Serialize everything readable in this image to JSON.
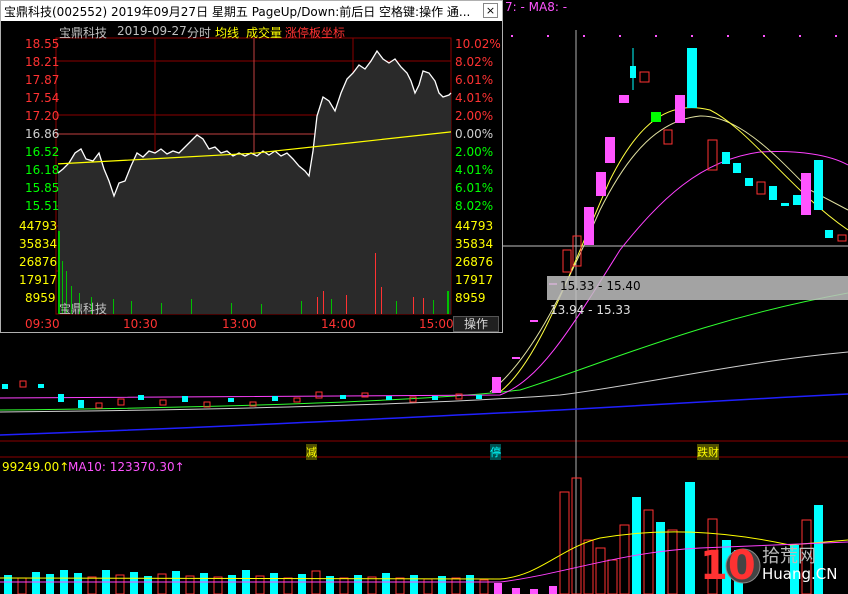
{
  "popup": {
    "title": "宝鼎科技(002552)  2019年09月27日  星期五  PageUp/Down:前后日  空格键:操作  通...",
    "close_glyph": "×",
    "stock_name": "宝鼎科技",
    "date": "2019-09-27",
    "chart_mode": "分时",
    "legend_avg": "均线",
    "legend_volume": "成交量",
    "legend_limit": "涨停板坐标",
    "vol_stock_name": "宝鼎科技",
    "operate_button": "操作",
    "price_levels": [
      "18.55",
      "18.21",
      "17.87",
      "17.54",
      "17.20",
      "16.86",
      "16.52",
      "16.18",
      "15.85",
      "15.51"
    ],
    "pct_levels": [
      "10.02%",
      "8.02%",
      "6.01%",
      "4.01%",
      "2.00%",
      "0.00%",
      "2.00%",
      "4.01%",
      "6.01%",
      "8.02%"
    ],
    "volume_levels": [
      "44793",
      "35834",
      "26876",
      "17917",
      "8959"
    ],
    "time_labels": [
      "09:30",
      "10:30",
      "13:00",
      "14:00",
      "15:00"
    ]
  },
  "kline": {
    "ma_header": "7: -   MA8: -",
    "price_box": "15.33  -  15.40",
    "price_line2": "13.94  -  15.33",
    "markers": [
      "减",
      "停",
      "跌财"
    ],
    "volume_header_left": "99249.00↑",
    "volume_header_ma": "MA10: 123370.30↑"
  },
  "watermark": {
    "number": "10",
    "chinese": "拾荒网",
    "latin": "Huang.CN"
  },
  "colors": {
    "up": "#ff3232",
    "down": "#00ffff",
    "limit_up": "#ff54ff",
    "avg_line": "#ffff00",
    "grid": "#8b0000"
  },
  "chart_data": {
    "type": "line",
    "title": "宝鼎科技 2019-09-27 分时",
    "x": [
      "09:30",
      "10:30",
      "13:00",
      "14:00",
      "15:00"
    ],
    "series": [
      {
        "name": "均线",
        "values": [
          16.3,
          16.4,
          16.5,
          16.7,
          16.9
        ]
      }
    ],
    "ylim": [
      15.51,
      18.55
    ],
    "ylabel": "",
    "xlabel": ""
  }
}
